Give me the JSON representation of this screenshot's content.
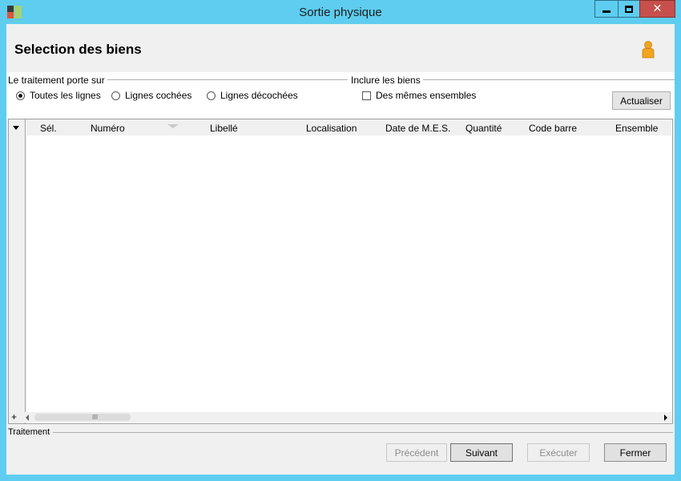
{
  "window": {
    "title": "Sortie physique",
    "controls": [
      "minimize-icon",
      "maximize-icon",
      "close-icon"
    ],
    "accent_color": "#5ecdf0",
    "close_color": "#c7504c"
  },
  "header": {
    "title": "Selection des biens",
    "icon": "user-icon"
  },
  "options": {
    "scope_group_label": "Le traitement porte sur",
    "scope_radios": [
      {
        "label": "Toutes les lignes",
        "checked": true
      },
      {
        "label": "Lignes cochées",
        "checked": false
      },
      {
        "label": "Lignes décochées",
        "checked": false
      }
    ],
    "include_group_label": "Inclure les biens",
    "include_checkbox": {
      "label": "Des mêmes ensembles",
      "checked": false
    },
    "refresh_button": "Actualiser"
  },
  "grid": {
    "columns": [
      "Sél.",
      "Numéro",
      "Libellé",
      "Localisation",
      "Date de M.E.S.",
      "Quantité",
      "Code barre",
      "Ensemble"
    ],
    "rows": [],
    "add_button": "+",
    "thumb_grip": "III"
  },
  "footer": {
    "group_label": "Traitement",
    "buttons": {
      "previous": "Précédent",
      "next": "Suivant",
      "execute": "Exécuter",
      "close": "Fermer"
    }
  }
}
